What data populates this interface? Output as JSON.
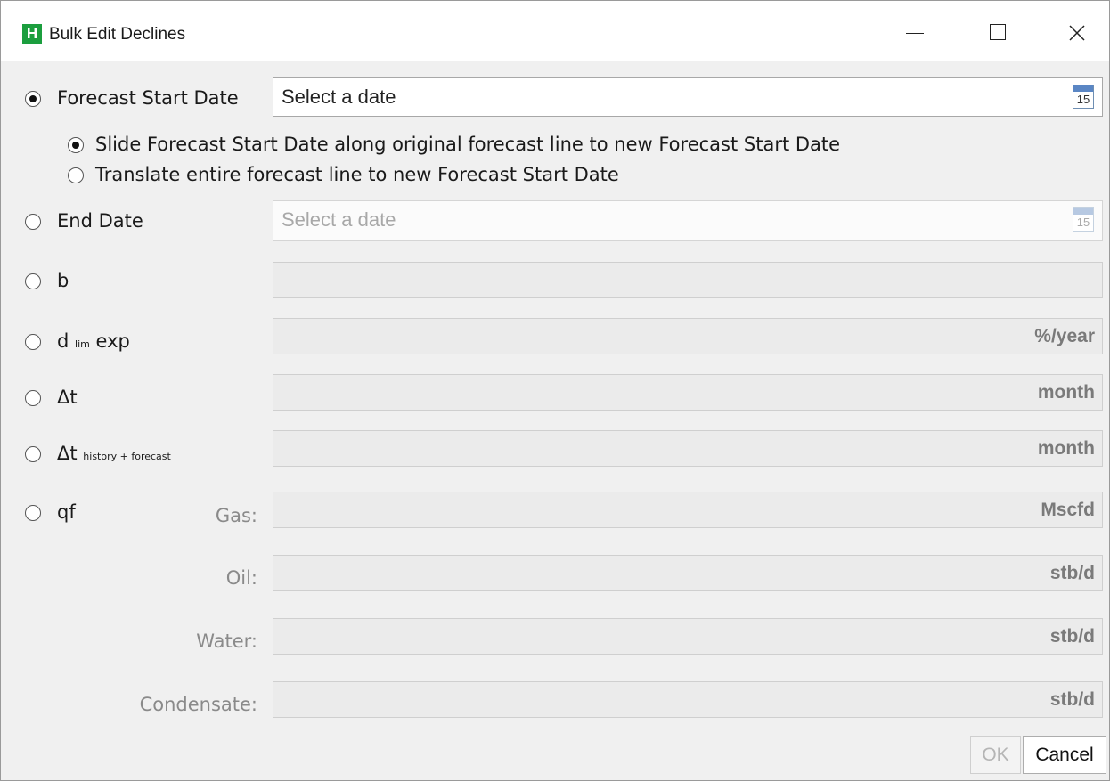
{
  "window": {
    "app_icon_letter": "H",
    "title": "Bulk Edit Declines"
  },
  "forecast_start": {
    "label": "Forecast Start Date",
    "placeholder": "Select a date",
    "calendar_day": "15",
    "selected": true,
    "options": [
      {
        "label": "Slide Forecast Start Date along original forecast line to new Forecast Start Date",
        "selected": true
      },
      {
        "label": "Translate entire forecast line to new Forecast Start Date",
        "selected": false
      }
    ]
  },
  "end_date": {
    "label": "End Date",
    "placeholder": "Select a date",
    "calendar_day": "15"
  },
  "b": {
    "label": "b"
  },
  "d_lim": {
    "label_main": "d",
    "label_sub": "lim",
    "label_suffix": "exp",
    "unit": "%/year"
  },
  "delta_t": {
    "label": "Δt",
    "unit": "month"
  },
  "delta_t_hf": {
    "label_main": "Δt",
    "label_sub": "history + forecast",
    "unit": "month"
  },
  "qf": {
    "label": "qf",
    "fields": [
      {
        "label": "Gas:",
        "unit": "Mscfd"
      },
      {
        "label": "Oil:",
        "unit": "stb/d"
      },
      {
        "label": "Water:",
        "unit": "stb/d"
      },
      {
        "label": "Condensate:",
        "unit": "stb/d"
      }
    ]
  },
  "buttons": {
    "ok": "OK",
    "cancel": "Cancel"
  }
}
